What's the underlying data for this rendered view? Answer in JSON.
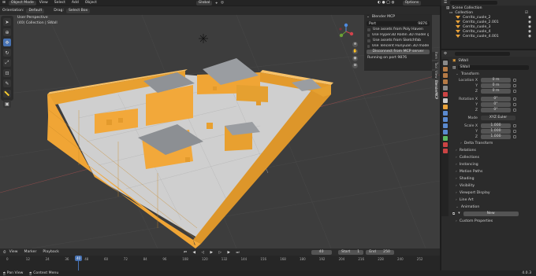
{
  "topmenu": {
    "mode": "Object Mode",
    "items": [
      "View",
      "Select",
      "Add",
      "Object"
    ],
    "transform": "Global",
    "options": "Options"
  },
  "header2": {
    "orientation_label": "Orientation:",
    "orientation_value": "Default",
    "drag_label": "Drag:",
    "drag_value": "Select Box"
  },
  "viewport": {
    "view_name": "User Perspective",
    "collection": "(40) Collection | SWall"
  },
  "mcp": {
    "title": "Blender MCP",
    "port_label": "Port",
    "port_value": "9876",
    "options": [
      "Use assets from Poly Haven",
      "Use Hyper3D Rodin 3D model generation",
      "Use assets from Sketchfab",
      "Use Tencent Hunyuan 3D model generation"
    ],
    "disconnect": "Disconnect from MCP server",
    "status": "Running on port 9876"
  },
  "sidetabs": [
    "Item",
    "Tool",
    "View",
    "BlenderMCP"
  ],
  "outliner": {
    "root": "Scene Collection",
    "collection": "Collection",
    "items": [
      "Cerrito_cuole_2",
      "Cerrito_cuole_2.001",
      "Cerrito_cuole_3",
      "Cerrito_cuole_4",
      "Cerrito_cuole_4.001"
    ]
  },
  "properties": {
    "object_name": "SWall",
    "data_name": "SWall",
    "transform_title": "Transform",
    "location_label": "Location X",
    "location": [
      "0 m",
      "0 m",
      "0 m"
    ],
    "rotation_label": "Rotation X",
    "rotation": [
      "0°",
      "0°",
      "0°"
    ],
    "mode_label": "Mode",
    "mode_value": "XYZ Euler",
    "scale_label": "Scale X",
    "scale": [
      "1.000",
      "1.000",
      "1.000"
    ],
    "axis_labels": [
      "Y",
      "Z"
    ],
    "delta": "Delta Transform",
    "sections": [
      "Relations",
      "Collections",
      "Instancing",
      "Motion Paths",
      "Shading",
      "Visibility",
      "Viewport Display",
      "Line Art"
    ],
    "animation_title": "Animation",
    "new_label": "New",
    "custom": "Custom Properties"
  },
  "timeline": {
    "menus": [
      "View",
      "Marker",
      "Playback"
    ],
    "current_frame": "40",
    "start_label": "Start",
    "start": "1",
    "end_label": "End",
    "end": "250",
    "ticks": [
      "0",
      "12",
      "24",
      "36",
      "48",
      "60",
      "72",
      "84",
      "96",
      "108",
      "120",
      "132",
      "144",
      "156",
      "168",
      "180",
      "192",
      "204",
      "216",
      "228",
      "240",
      "252"
    ]
  },
  "status": {
    "left": "Pan View",
    "middle": "Context Menu",
    "version": "4.0.3"
  },
  "colors": {
    "wall": "#f2a83a",
    "roof": "#8f9296",
    "floor": "#c9c9c9",
    "accent": "#4772b3",
    "selection": "#e8a23b"
  }
}
